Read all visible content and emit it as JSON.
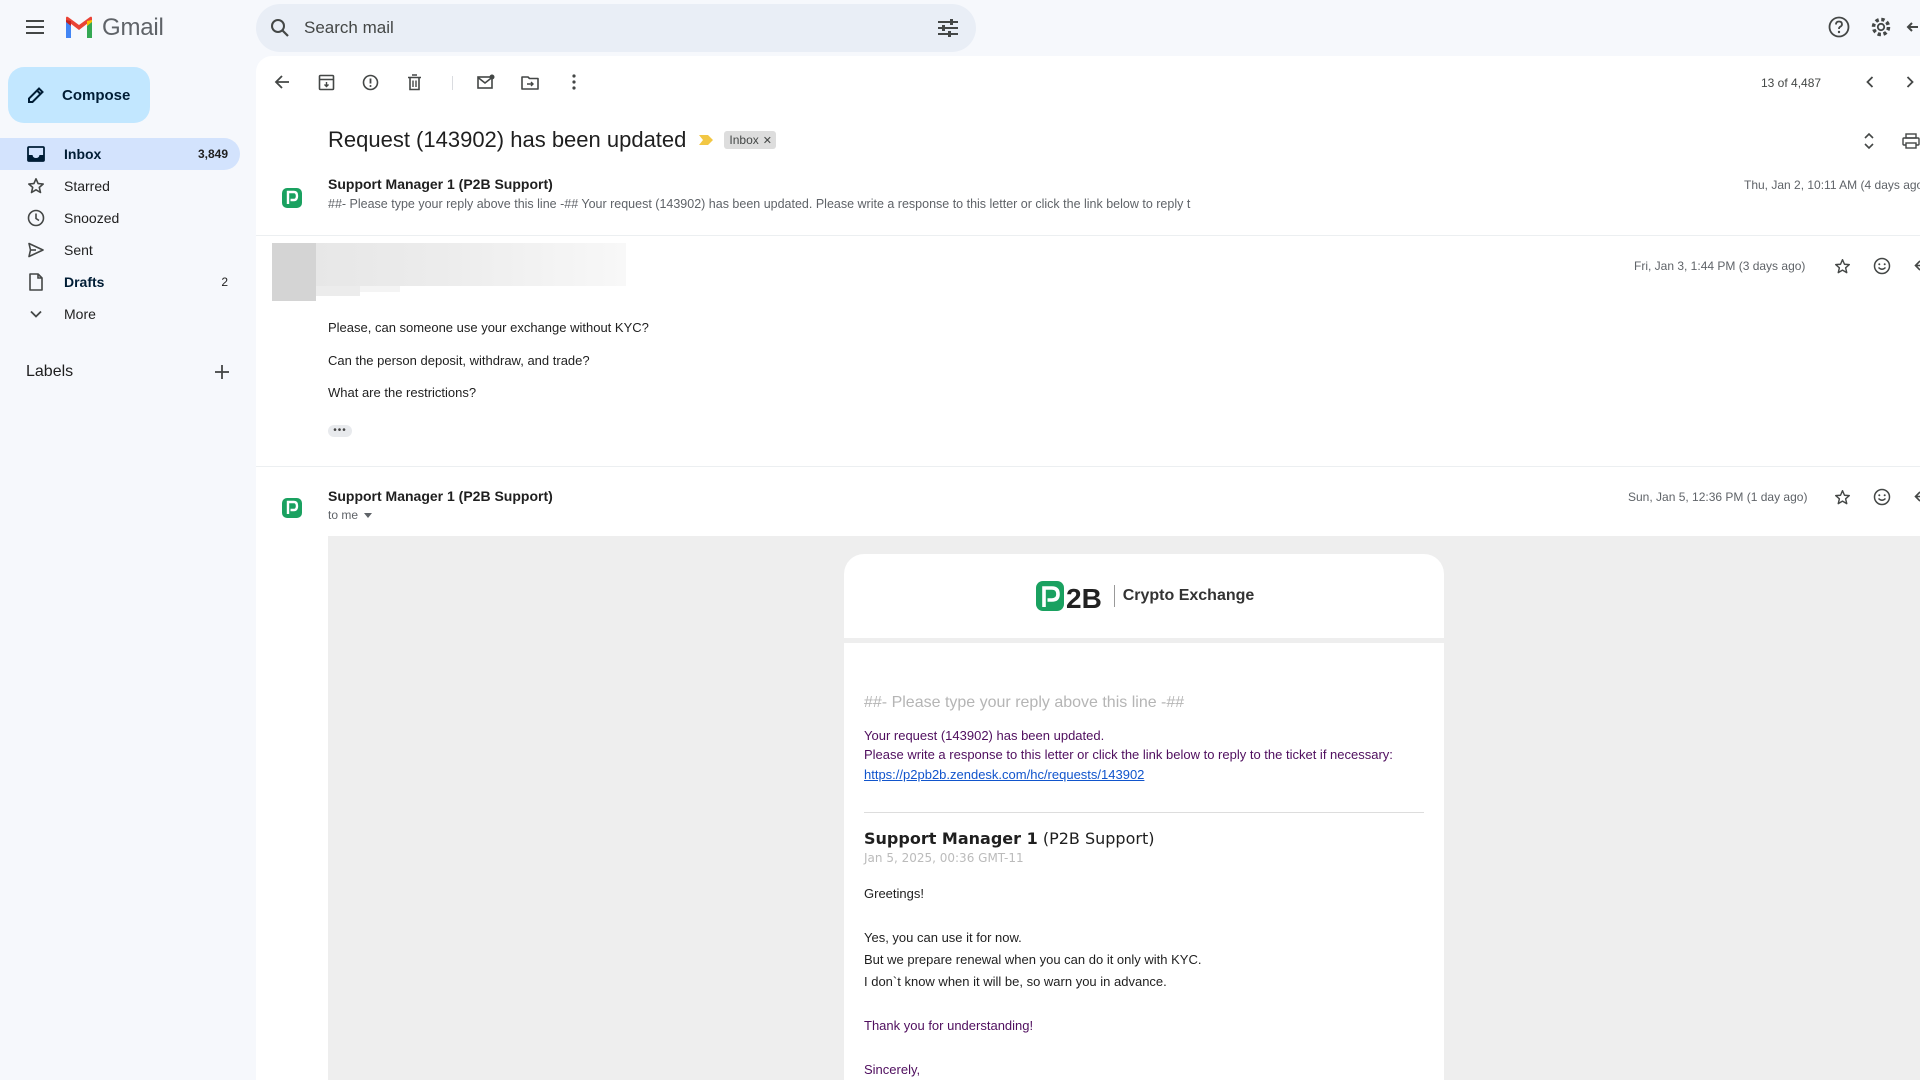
{
  "app": {
    "name": "Gmail"
  },
  "search": {
    "placeholder": "Search mail"
  },
  "compose": {
    "label": "Compose"
  },
  "nav": [
    {
      "label": "Inbox",
      "count": "3,849",
      "icon": "inbox-icon"
    },
    {
      "label": "Starred",
      "count": "",
      "icon": "star-icon"
    },
    {
      "label": "Snoozed",
      "count": "",
      "icon": "clock-icon"
    },
    {
      "label": "Sent",
      "count": "",
      "icon": "send-icon"
    },
    {
      "label": "Drafts",
      "count": "2",
      "icon": "draft-icon"
    },
    {
      "label": "More",
      "count": "",
      "icon": "chevron-down-icon"
    }
  ],
  "labels": {
    "title": "Labels"
  },
  "toolbar": {
    "pager": "13 of 4,487"
  },
  "thread": {
    "subject": "Request (143902) has been updated",
    "chip": "Inbox"
  },
  "messages": [
    {
      "sender": "Support Manager 1 (P2B Support)",
      "snippet": "##- Please type your reply above this line -## Your request (143902) has been updated. Please write a response to this letter or click the link below to reply t",
      "date": "Thu, Jan 2, 10:11 AM (4 days ago)"
    },
    {
      "date": "Fri, Jan 3, 1:44 PM (3 days ago)",
      "body": [
        "Please, can someone use your exchange without KYC?",
        "Can the person deposit, withdraw, and trade?",
        "What are the restrictions?"
      ],
      "ellipsis": "•••"
    },
    {
      "sender": "Support Manager 1 (P2B Support)",
      "to": "to me",
      "date": "Sun, Jan 5, 12:36 PM (1 day ago)"
    }
  ],
  "email": {
    "brand": "Crypto Exchange",
    "logo_text": "2B",
    "hint": "##- Please type your reply above this line -##",
    "line1": "Your request (143902) has been updated.",
    "line2": "Please write a response to this letter or click the link below to reply to the ticket if necessary:",
    "link": "https://p2pb2b.zendesk.com/hc/requests/143902",
    "agent_name": "Support Manager 1",
    "agent_org": "(P2B Support)",
    "agent_date": "Jan 5, 2025, 00:36 GMT-11",
    "greeting": "Greetings!",
    "reply1": "Yes, you can use it for now.",
    "reply2": "But we prepare renewal when you can do it only with KYC.",
    "reply3": "I don`t know when it will be, so warn you in advance.",
    "thanks": "Thank you for understanding!",
    "sign": "Sincerely,"
  },
  "colors": {
    "accent": "#c2e7ff",
    "active_nav": "#d3e3fd",
    "brand_green": "#1aa160",
    "email_purple": "#4f0e5e",
    "link_blue": "#1155cc"
  }
}
